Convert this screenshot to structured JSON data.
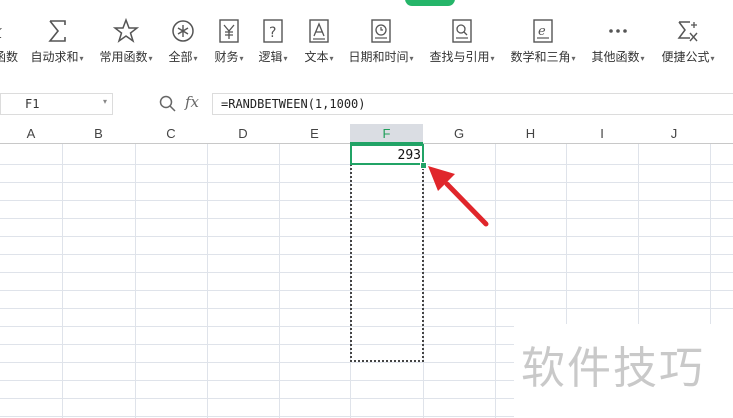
{
  "ribbon": {
    "items": [
      {
        "label": "函数",
        "icon": "fx-partial-icon",
        "caret": false
      },
      {
        "label": "自动求和",
        "icon": "sigma-icon",
        "caret": true
      },
      {
        "label": "常用函数",
        "icon": "star-icon",
        "caret": true
      },
      {
        "label": "全部",
        "icon": "asterisk-circle-icon",
        "caret": true
      },
      {
        "label": "财务",
        "icon": "yen-icon",
        "caret": true
      },
      {
        "label": "逻辑",
        "icon": "question-box-icon",
        "caret": true
      },
      {
        "label": "文本",
        "icon": "text-a-icon",
        "caret": true
      },
      {
        "label": "日期和时间",
        "icon": "clock-icon",
        "caret": true
      },
      {
        "label": "查找与引用",
        "icon": "search-doc-icon",
        "caret": true
      },
      {
        "label": "数学和三角",
        "icon": "theta-doc-icon",
        "caret": true
      },
      {
        "label": "其他函数",
        "icon": "more-dots-icon",
        "caret": true
      },
      {
        "label": "便捷公式",
        "icon": "sigma-x-icon",
        "caret": true
      }
    ]
  },
  "formula_bar": {
    "name_box": "F1",
    "fx_label": "fx",
    "formula": "=RANDBETWEEN(1,1000)"
  },
  "sheet": {
    "columns": [
      "A",
      "B",
      "C",
      "D",
      "E",
      "F",
      "G",
      "H",
      "I",
      "J"
    ],
    "active_column": "F",
    "active_cell_value": "293"
  },
  "watermark": "软件技巧",
  "colors": {
    "accent": "#21a366",
    "arrow": "#e0262b",
    "grid": "#dfe3ea"
  }
}
